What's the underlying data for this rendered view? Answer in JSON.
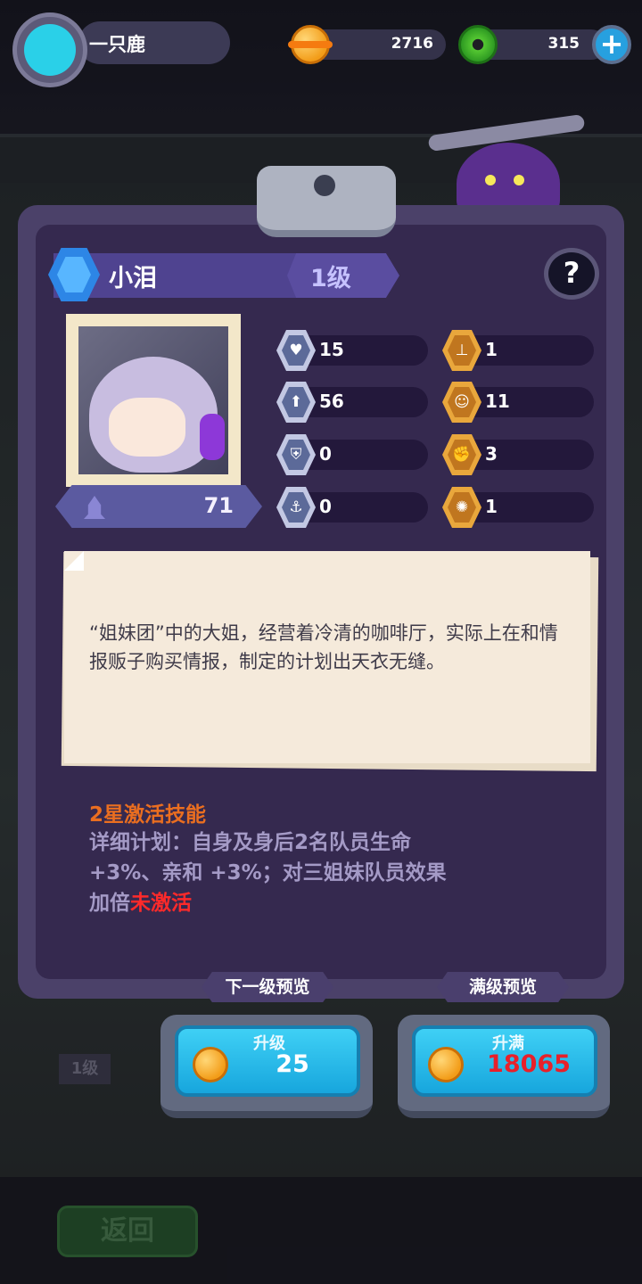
{
  "player": {
    "name": "一只鹿"
  },
  "resources": {
    "coins": "2716",
    "gems": "315"
  },
  "character": {
    "name": "小泪",
    "level": "1级",
    "power": "71"
  },
  "stats_left": [
    {
      "icon": "heart-icon",
      "glyph": "♥",
      "value": "15"
    },
    {
      "icon": "bell-icon",
      "glyph": "⬆",
      "value": "56"
    },
    {
      "icon": "shield-icon",
      "glyph": "⛨",
      "value": "0"
    },
    {
      "icon": "anchor-icon",
      "glyph": "⚓",
      "value": "0"
    }
  ],
  "stats_right": [
    {
      "icon": "stamp-icon",
      "glyph": "⊥",
      "value": "1"
    },
    {
      "icon": "smile-icon",
      "glyph": "☺",
      "value": "11"
    },
    {
      "icon": "muscle-icon",
      "glyph": "✊",
      "value": "3"
    },
    {
      "icon": "brain-icon",
      "glyph": "✺",
      "value": "1"
    }
  ],
  "description": "“姐妹团”中的大姐，经营着冷清的咖啡厅，实际上在和情报贩子购买情报，制定的计划出天衣无缝。",
  "skill": {
    "title": "2星激活技能",
    "text": "详细计划：自身及身后2名队员生命 +3%、亲和 +3%；对三姐妹队员效果加倍",
    "status": "未激活"
  },
  "preview": {
    "next_level": "下一级预览",
    "max_level": "满级预览"
  },
  "upgrade": {
    "label": "升级",
    "cost": "25"
  },
  "upgrade_max": {
    "label": "升满",
    "cost": "18065"
  },
  "background": {
    "back_label": "返回",
    "level_tag": "1级"
  },
  "colors": {
    "accent": "#4f4390",
    "cost_red": "#e8202a",
    "status_red": "#ff2a2a",
    "skill_orange": "#ea6e20"
  }
}
